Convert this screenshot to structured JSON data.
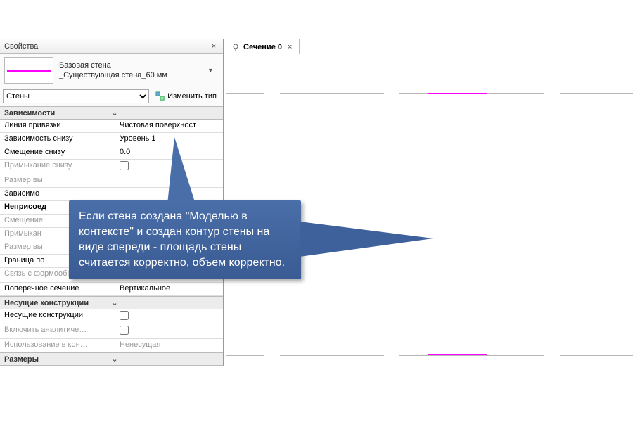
{
  "panel": {
    "title": "Свойства",
    "type_line1": "Базовая стена",
    "type_line2": "_Существующая стена_60 мм",
    "filter": "Стены",
    "edit_type": "Изменить тип"
  },
  "groups": {
    "g1": "Зависимости",
    "g2": "Несущие конструкции",
    "g3": "Размеры"
  },
  "props": {
    "p1n": "Линия привязки",
    "p1v": "Чистовая поверхност",
    "p2n": "Зависимость снизу",
    "p2v": "Уровень 1",
    "p3n": "Смещение снизу",
    "p3v": "0.0",
    "p4n": "Примыкание снизу",
    "p5n": "Размер вы",
    "p6n": "Зависимо",
    "p7n": "Неприсоед",
    "p8n": "Смещение",
    "p9n": "Примыкан",
    "p10n": "Размер вы",
    "p11n": "Граница по",
    "p12n": "Связь с формообразо…",
    "p13n": "Поперечное сечение",
    "p13v": "Вертикальное",
    "p14n": "Несущие конструкции",
    "p15n": "Включить аналитиче…",
    "p16n": "Использование в кон…",
    "p16v": "Ненесущая"
  },
  "tab": {
    "label": "Сечение 0"
  },
  "callout": {
    "text": "Если стена создана \"Моделью в контексте\" и создан контур стены на виде спереди - площадь стены считается корректно, объем корректно."
  }
}
